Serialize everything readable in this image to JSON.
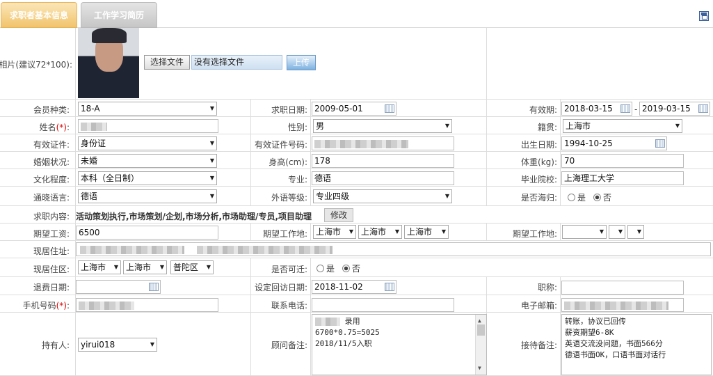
{
  "tabs": {
    "basic": "求职者基本信息",
    "history": "工作学习简历"
  },
  "photo": {
    "label": "相片(建议72*100):",
    "choose": "选择文件",
    "none": "没有选择文件",
    "upload": "上传"
  },
  "member": {
    "label": "会员种类:",
    "value": "18-A"
  },
  "jobdate": {
    "label": "求职日期:",
    "value": "2009-05-01"
  },
  "valid": {
    "label": "有效期:",
    "from": "2018-03-15",
    "sep": "-",
    "to": "2019-03-15"
  },
  "name": {
    "label": "姓名",
    "req": "(*)",
    "colon": ":"
  },
  "gender": {
    "label": "性别:",
    "value": "男"
  },
  "native": {
    "label": "籍贯:",
    "value": "上海市"
  },
  "idtype": {
    "label": "有效证件:",
    "value": "身份证"
  },
  "idno": {
    "label": "有效证件号码:"
  },
  "birth": {
    "label": "出生日期:",
    "value": "1994-10-25"
  },
  "marital": {
    "label": "婚姻状况:",
    "value": "未婚"
  },
  "height": {
    "label": "身高(cm):",
    "value": "178"
  },
  "weight": {
    "label": "体重(kg):",
    "value": "70"
  },
  "edu": {
    "label": "文化程度:",
    "value": "本科（全日制）"
  },
  "major": {
    "label": "专业:",
    "value": "德语"
  },
  "school": {
    "label": "毕业院校:",
    "value": "上海理工大学"
  },
  "lang": {
    "label": "通晓语言:",
    "value": "德语"
  },
  "langlevel": {
    "label": "外语等级:",
    "value": "专业四级"
  },
  "returnee": {
    "label": "是否海归:",
    "yes": "是",
    "no": "否"
  },
  "jobcontent": {
    "label": "求职内容:",
    "value": "活动策划执行,市场策划/企划,市场分析,市场助理/专员,项目助理",
    "edit": "修改"
  },
  "salary": {
    "label": "期望工资:",
    "value": "6500"
  },
  "workplace1": {
    "label": "期望工作地:",
    "v1": "上海市",
    "v2": "上海市",
    "v3": "上海市"
  },
  "workplace2": {
    "label": "期望工作地:"
  },
  "address": {
    "label": "现居住址:"
  },
  "district": {
    "label": "现居住区:",
    "v1": "上海市",
    "v2": "上海市",
    "v3": "普陀区"
  },
  "relocate": {
    "label": "是否可迁:",
    "yes": "是",
    "no": "否"
  },
  "refund": {
    "label": "退费日期:"
  },
  "visitdate": {
    "label": "设定回访日期:",
    "value": "2018-11-02"
  },
  "title": {
    "label": "职称:"
  },
  "mobile": {
    "label": "手机号码",
    "req": "(*)",
    "colon": ":"
  },
  "phone": {
    "label": "联系电话:"
  },
  "email": {
    "label": "电子邮箱:"
  },
  "holder": {
    "label": "持有人:",
    "value": "yirui018"
  },
  "advisor": {
    "label": "顾问备注:",
    "l1": "录用",
    "l2": "6700*0.75=5025",
    "l3": "2018/11/5入职"
  },
  "reception": {
    "label": "接待备注:",
    "l1": "转账，协议已回传",
    "l2": "薪资期望6-8K",
    "l3": "英语交流没问题，书面566分",
    "l4": "德语书面OK，口语书面对话行"
  }
}
